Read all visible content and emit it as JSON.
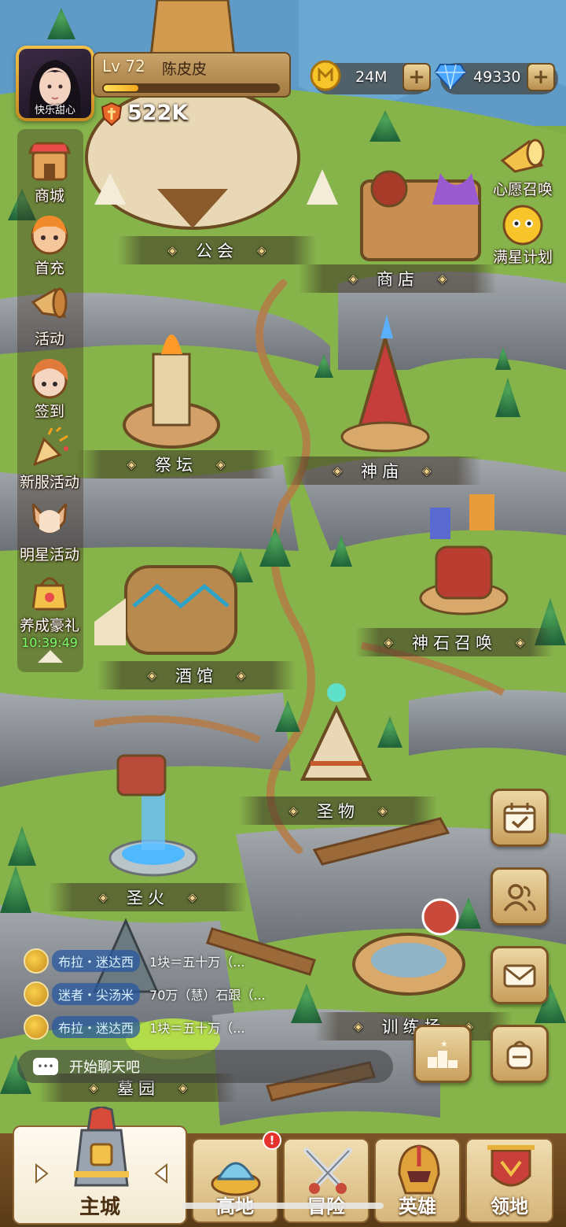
{
  "player": {
    "avatar_name": "快乐甜心",
    "level": "Lv 72",
    "name": "陈皮皮",
    "xp_fraction": 0.2,
    "power": "522K"
  },
  "resources": {
    "gold": "24M",
    "gems": "49330"
  },
  "side_menu": [
    {
      "label": "商城",
      "icon": "shop-icon"
    },
    {
      "label": "首充",
      "icon": "first-recharge-icon"
    },
    {
      "label": "活动",
      "icon": "horn-icon"
    },
    {
      "label": "签到",
      "icon": "checkin-icon"
    },
    {
      "label": "新服活动",
      "icon": "party-popper-icon"
    },
    {
      "label": "明星活动",
      "icon": "star-hero-icon"
    },
    {
      "label": "养成豪礼",
      "icon": "gift-bag-icon"
    }
  ],
  "gift_timer": "10:39:49",
  "right_top_menu": [
    {
      "label": "心愿召唤",
      "icon": "wish-horn-icon"
    },
    {
      "label": "满星计划",
      "icon": "star-plan-icon"
    }
  ],
  "buildings": {
    "guild": "公会",
    "shop": "商店",
    "altar": "祭坛",
    "temple": "神庙",
    "stone_summon": "神石召唤",
    "tavern": "酒馆",
    "relic": "圣物",
    "holy_fire": "圣火",
    "training": "训练场",
    "graveyard": "墓园"
  },
  "chat": {
    "messages": [
      {
        "nick": "布拉・迷达西",
        "text": "1块＝五十万（..."
      },
      {
        "nick": "迷者・尖汤米",
        "text": "70万（慧）石跟（..."
      },
      {
        "nick": "布拉・迷达西",
        "text": "1块＝五十万（..."
      }
    ],
    "placeholder": "开始聊天吧"
  },
  "bottom_nav": [
    {
      "label": "主城",
      "active": true
    },
    {
      "label": "高地",
      "badge": "!"
    },
    {
      "label": "冒险"
    },
    {
      "label": "英雄"
    },
    {
      "label": "领地"
    }
  ],
  "colors": {
    "grass": "#7fae45",
    "cliff": "#8e949a",
    "path": "#b57a45",
    "wood": "#7a5327"
  }
}
